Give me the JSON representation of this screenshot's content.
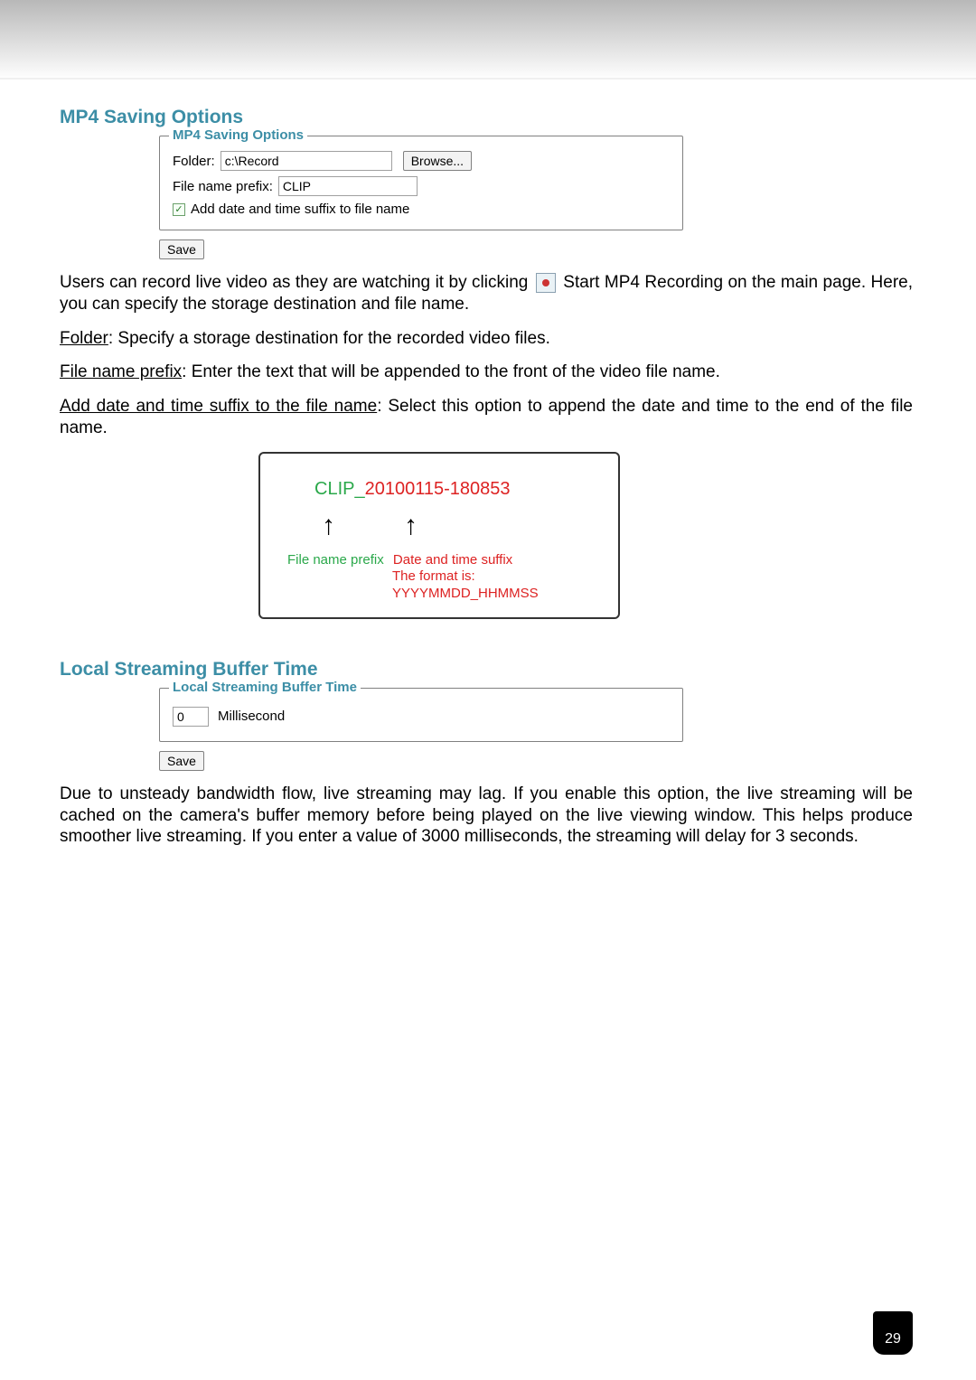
{
  "page_number": "29",
  "mp4": {
    "section_title": "MP4 Saving Options",
    "legend": "MP4 Saving Options",
    "folder_label": "Folder:",
    "folder_value": "c:\\Record",
    "browse_label": "Browse...",
    "prefix_label": "File name prefix:",
    "prefix_value": "CLIP",
    "checkbox_label": "Add date and time suffix to file name",
    "save_label": "Save"
  },
  "paragraphs": {
    "intro_pre": "Users can record live video as they are watching it by clicking",
    "intro_post": "Start MP4 Recording on the main page. Here, you can specify the storage destination and file name.",
    "folder_label": "Folder",
    "folder_text": ": Specify a storage destination for the recorded video files.",
    "prefix_label": "File name prefix",
    "prefix_text": ": Enter the text that will be appended to the front of the video file name.",
    "suffix_label": "Add date and time suffix to the file name",
    "suffix_text": ": Select this option to append the date and time to the end of the file name."
  },
  "example": {
    "clip": "CLIP_",
    "datetime": "20100115-180853",
    "prefix_caption": "File name prefix",
    "suffix_caption": "Date and time suffix",
    "format_caption": "The format is: YYYYMMDD_HHMMSS"
  },
  "buffer": {
    "section_title": "Local Streaming Buffer Time",
    "legend": "Local Streaming Buffer Time",
    "value": "0",
    "unit": "Millisecond",
    "save_label": "Save",
    "paragraph": "Due to unsteady bandwidth flow, live streaming may lag. If you enable this option, the live streaming will be cached on the camera's buffer memory before being played on the live viewing window. This helps produce smoother live streaming. If you enter a value of 3000 milliseconds, the streaming will delay for 3 seconds."
  }
}
